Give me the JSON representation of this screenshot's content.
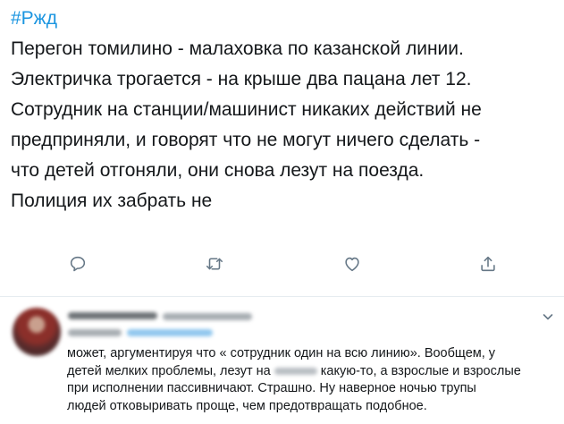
{
  "tweet": {
    "hashtag": "#Ржд",
    "lines": [
      "Перегон томилино - малаховка по казанской линии.",
      "Электричка трогается - на крыше два пацана лет 12.",
      "Сотрудник на станции/машинист никаких действий не",
      "предприняли, и говорят что не могут ничего сделать -",
      "что детей отгоняли, они снова лезут на поезда.",
      "Полиция их забрать не"
    ]
  },
  "actions": [
    {
      "name": "reply-icon"
    },
    {
      "name": "retweet-icon"
    },
    {
      "name": "like-icon"
    },
    {
      "name": "share-icon"
    }
  ],
  "reply": {
    "line1": "может, аргументируя что « сотрудник один на всю линию». Вообщем, у",
    "line2_before": "детей мелких проблемы, лезут на",
    "line2_after": "какую-то, а взрослые и взрослые",
    "line3": "при исполнении пассивничают. Страшно. Ну наверное ночью трупы",
    "line4": "людей отковыривать проще, чем предотвращать подобное."
  },
  "colors": {
    "accent": "#1b95e0",
    "icon": "#657786",
    "text": "#14171a",
    "divider": "#e6ecf0"
  }
}
